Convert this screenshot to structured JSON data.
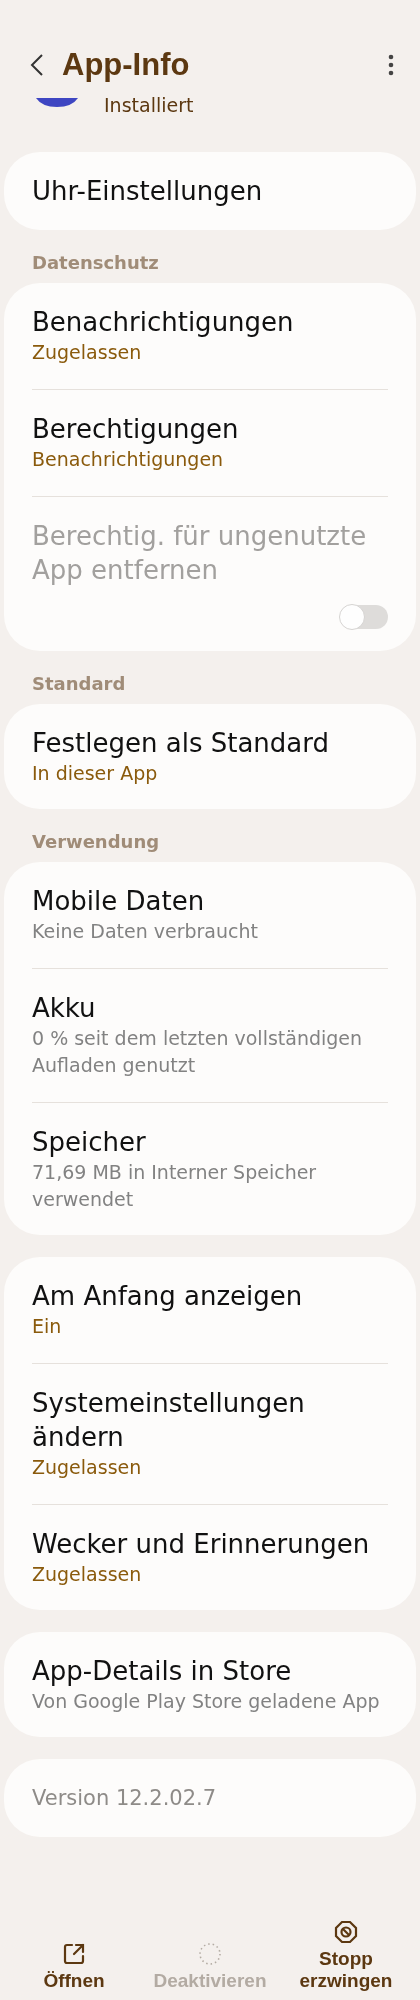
{
  "header": {
    "title": "App-Info"
  },
  "app": {
    "status": "Installiert"
  },
  "groups": [
    {
      "items": [
        {
          "kind": "link",
          "title": "Uhr-Einstellungen",
          "disabled": false
        }
      ]
    },
    {
      "heading": "Datenschutz",
      "items": [
        {
          "kind": "link",
          "title": "Benachrichtigungen",
          "subtitle": {
            "kind": "status",
            "text": "Zugelassen"
          },
          "disabled": false
        },
        {
          "kind": "link",
          "title": "Berechtigungen",
          "subtitle": {
            "kind": "status",
            "text": "Benachrichtigungen"
          },
          "disabled": false
        },
        {
          "kind": "toggle",
          "title": "Berechtig. für ungenutzte App entfernen",
          "disabled": true,
          "on": false
        }
      ]
    },
    {
      "heading": "Standard",
      "items": [
        {
          "kind": "link",
          "title": "Festlegen als Standard",
          "subtitle": {
            "kind": "status",
            "text": "In dieser App"
          },
          "disabled": false
        }
      ]
    },
    {
      "heading": "Verwendung",
      "items": [
        {
          "kind": "link",
          "title": "Mobile Daten",
          "subtitle": {
            "kind": "info",
            "text": "Keine Daten verbraucht"
          },
          "disabled": false
        },
        {
          "kind": "link",
          "title": "Akku",
          "subtitle": {
            "kind": "info",
            "text": "0 % seit dem letzten vollständigen Aufladen genutzt"
          },
          "disabled": false
        },
        {
          "kind": "link",
          "title": "Speicher",
          "subtitle": {
            "kind": "info",
            "text": "71,69 MB in Interner Speicher verwendet"
          },
          "disabled": false
        }
      ]
    },
    {
      "items": [
        {
          "kind": "link",
          "title": "Am Anfang anzeigen",
          "subtitle": {
            "kind": "status",
            "text": "Ein"
          },
          "disabled": false
        },
        {
          "kind": "link",
          "title": "Systemeinstellungen ändern",
          "subtitle": {
            "kind": "status",
            "text": "Zugelassen"
          },
          "disabled": false
        },
        {
          "kind": "link",
          "title": "Wecker und Erinnerungen",
          "subtitle": {
            "kind": "status",
            "text": "Zugelassen"
          },
          "disabled": false
        }
      ]
    },
    {
      "items": [
        {
          "kind": "link",
          "title": "App-Details in Store",
          "subtitle": {
            "kind": "info",
            "text": "Von Google Play Store geladene App"
          },
          "disabled": false
        }
      ]
    },
    {
      "items": [
        {
          "kind": "note",
          "title": "Version 12.2.02.7",
          "disabled": false
        }
      ]
    }
  ],
  "actions": [
    {
      "kind": "open",
      "label": "Öffnen",
      "disabled": false
    },
    {
      "kind": "deactivate",
      "label": "Deaktivieren",
      "disabled": true
    },
    {
      "kind": "stop",
      "label": "Stopp erzwingen",
      "disabled": false
    }
  ]
}
